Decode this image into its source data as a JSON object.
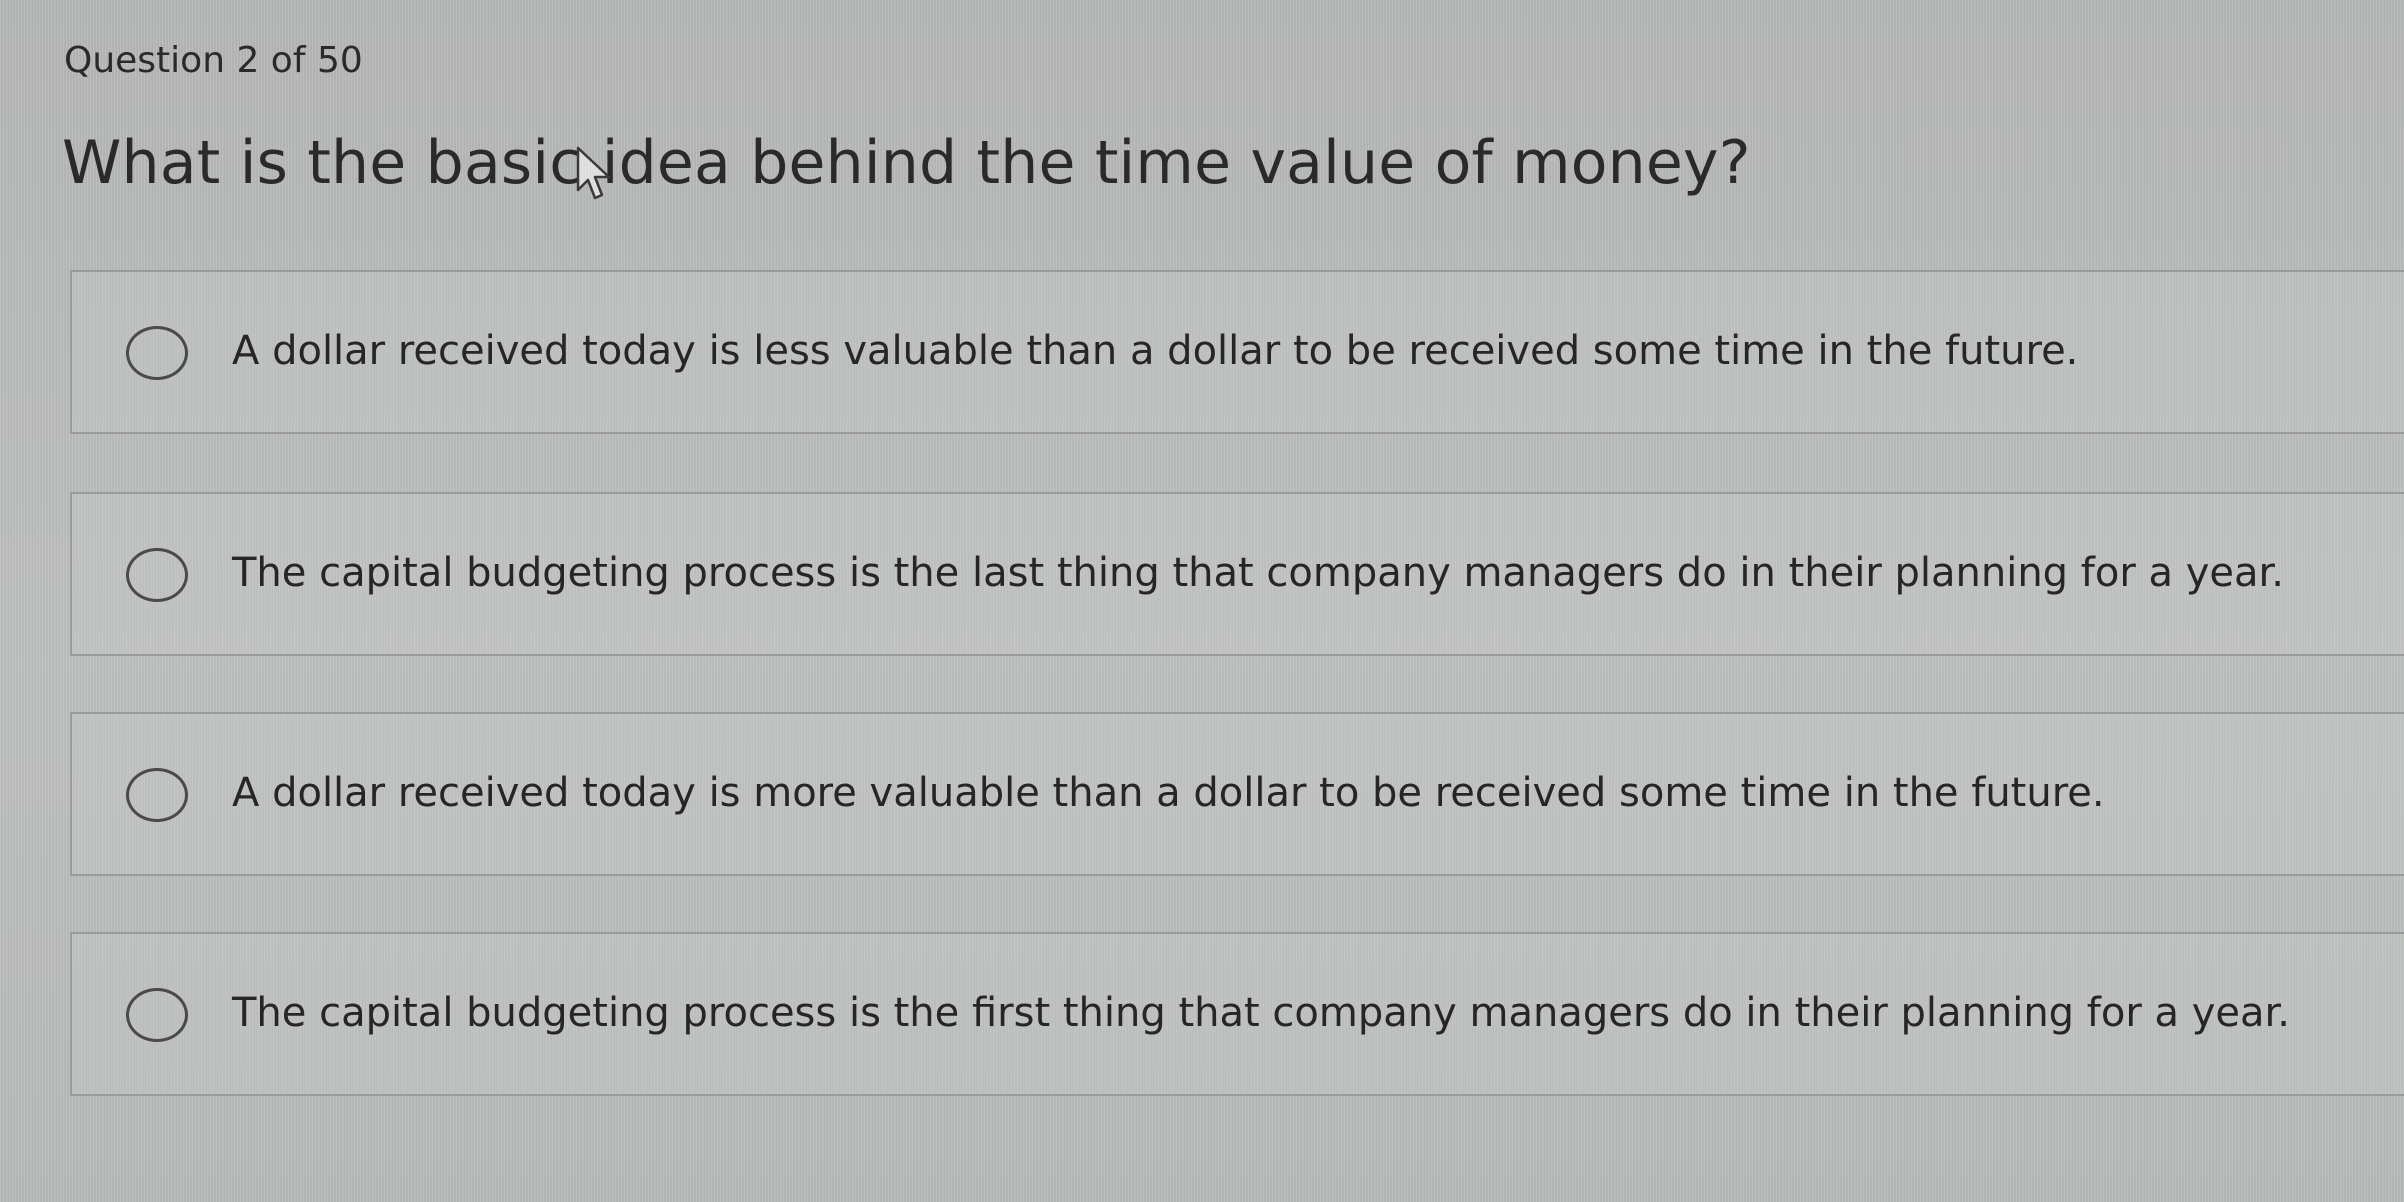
{
  "header": {
    "counter": "Question 2 of 50"
  },
  "question": {
    "text": "What is the basic idea behind the time value of money?"
  },
  "options": [
    {
      "label": "A dollar received today is less valuable than a dollar to be received some time in the future.",
      "selected": false
    },
    {
      "label": "The capital budgeting process is the last thing that company managers do in their planning for a year.",
      "selected": false
    },
    {
      "label": "A dollar received today is more valuable than a dollar to be received some time in the future.",
      "selected": false
    },
    {
      "label": "The capital budgeting process is the first thing that company managers do in their planning for a year.",
      "selected": false
    }
  ],
  "icons": {
    "cursor": "mouse-pointer-icon",
    "radio": "radio-button-icon"
  }
}
